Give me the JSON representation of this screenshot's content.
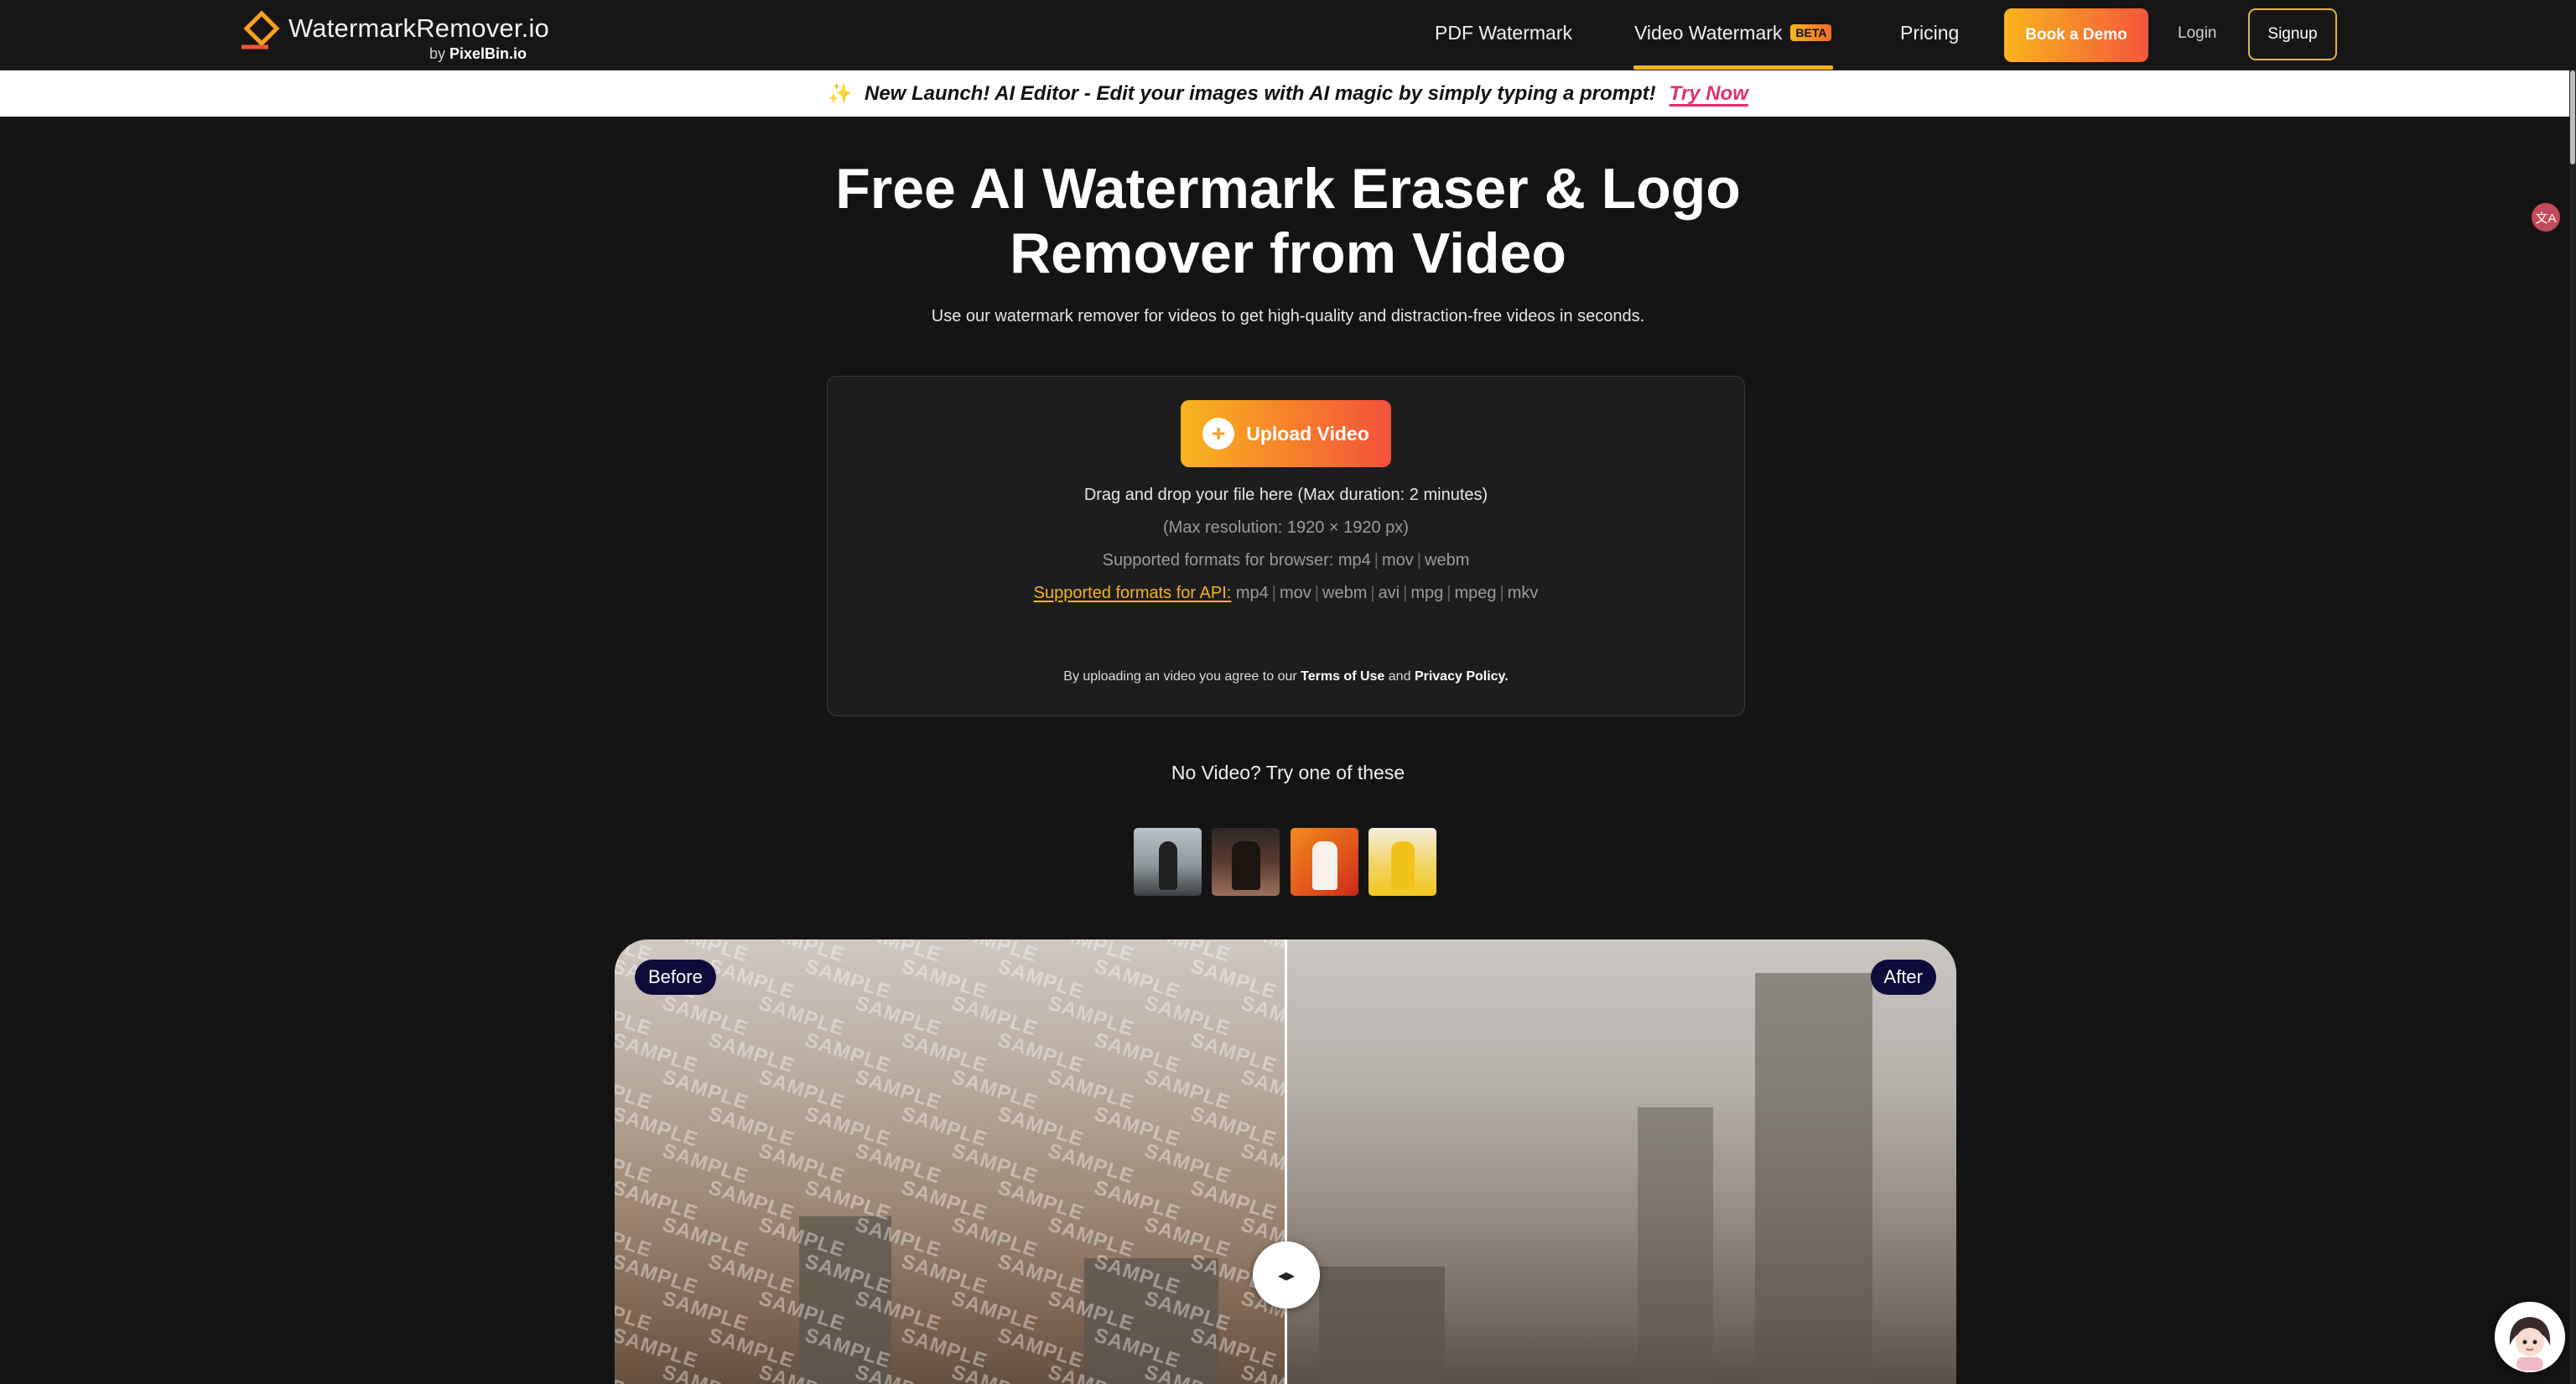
{
  "header": {
    "brand": {
      "name": "WatermarkRemover.io",
      "by_prefix": "by",
      "by_brand": "PixelBin.io",
      "logo_icon": "diamond-logo-icon"
    },
    "nav": {
      "pdf": "PDF Watermark",
      "video": "Video Watermark",
      "video_badge": "BETA",
      "pricing": "Pricing"
    },
    "book_demo": "Book a Demo",
    "login": "Login",
    "signup": "Signup"
  },
  "announcement": {
    "icon": "sparkle-icon",
    "text": "New Launch! AI Editor - Edit your images with AI magic by simply typing a prompt!",
    "cta": "Try Now"
  },
  "hero": {
    "title_line1": "Free AI Watermark Eraser & Logo",
    "title_line2": "Remover from Video",
    "subtitle": "Use our watermark remover for videos to get high-quality and distraction-free videos in seconds."
  },
  "upload": {
    "button_label": "Upload Video",
    "button_icon": "plus-circle-icon",
    "drag_text": "Drag and drop your file here (Max duration: 2 minutes)",
    "resolution_text": "(Max resolution: 1920 × 1920 px)",
    "browser_formats_label": "Supported formats for browser:",
    "browser_formats": [
      "mp4",
      "mov",
      "webm"
    ],
    "api_formats_label": "Supported formats for API:",
    "api_formats": [
      "mp4",
      "mov",
      "webm",
      "avi",
      "mpg",
      "mpeg",
      "mkv"
    ],
    "terms_prefix": "By uploading an video you agree to our",
    "terms_link": "Terms of Use",
    "terms_and": "and",
    "privacy_link": "Privacy Policy."
  },
  "samples": {
    "heading": "No Video? Try one of these",
    "items": [
      "sample-video-1",
      "sample-video-2",
      "sample-video-3",
      "sample-video-4"
    ]
  },
  "compare": {
    "before_label": "Before",
    "after_label": "After",
    "watermark_text": "SAMPLE",
    "handle_icon": "left-right-arrows-icon"
  },
  "colors": {
    "accent_start": "#f9b51c",
    "accent_end": "#f3513b",
    "background": "#141414",
    "try_now": "#e2306b"
  }
}
